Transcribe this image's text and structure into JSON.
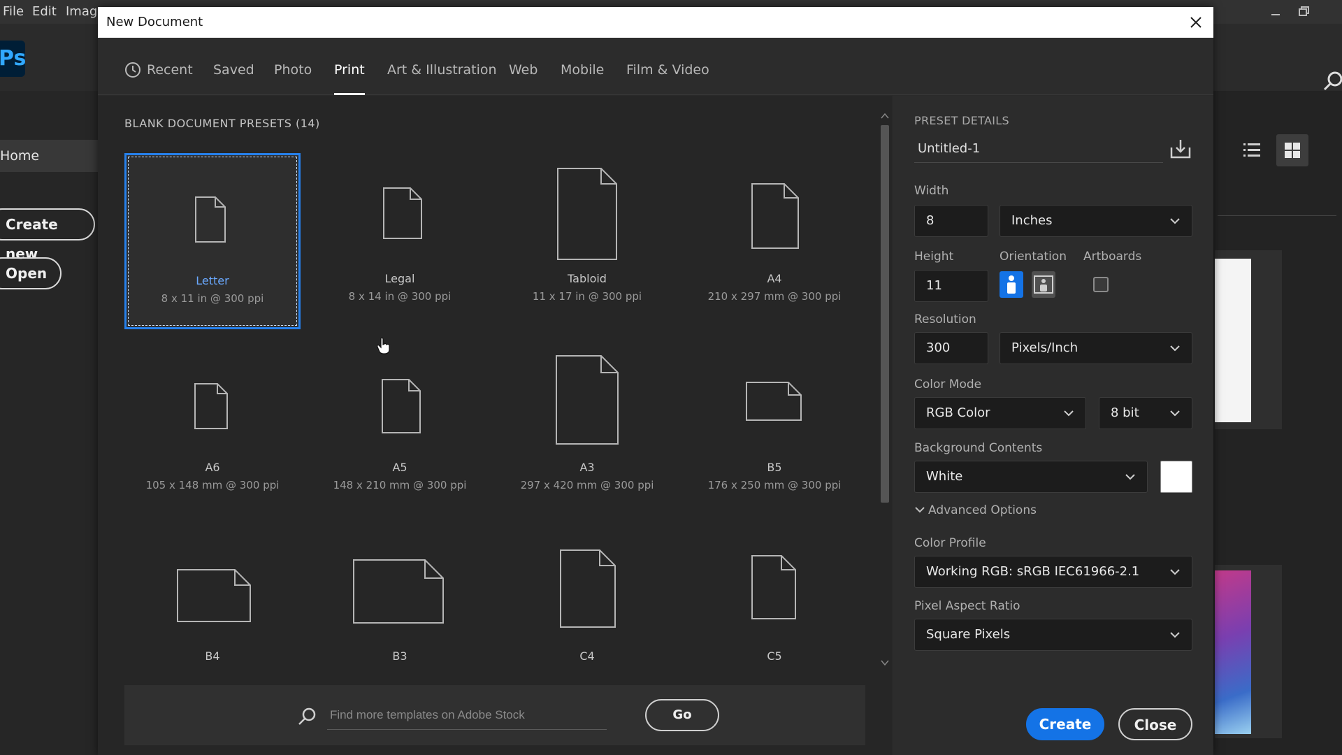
{
  "menubar": {
    "items": [
      "File",
      "Edit",
      "Image"
    ]
  },
  "app": {
    "logo": "Ps",
    "home_label": "Home",
    "create_new_label": "Create new",
    "open_label": "Open"
  },
  "dialog": {
    "title": "New Document",
    "tabs": [
      {
        "label": "Recent",
        "icon": "clock-icon"
      },
      {
        "label": "Saved"
      },
      {
        "label": "Photo"
      },
      {
        "label": "Print",
        "active": true
      },
      {
        "label": "Art & Illustration"
      },
      {
        "label": "Web"
      },
      {
        "label": "Mobile"
      },
      {
        "label": "Film & Video"
      }
    ],
    "presets_heading": "BLANK DOCUMENT PRESETS",
    "presets_count": "(14)",
    "presets": [
      {
        "name": "Letter",
        "size": "8 x 11 in @ 300 ppi",
        "selected": true
      },
      {
        "name": "Legal",
        "size": "8 x 14 in @ 300 ppi"
      },
      {
        "name": "Tabloid",
        "size": "11 x 17 in @ 300 ppi"
      },
      {
        "name": "A4",
        "size": "210 x 297 mm @ 300 ppi"
      },
      {
        "name": "A6",
        "size": "105 x 148 mm @ 300 ppi"
      },
      {
        "name": "A5",
        "size": "148 x 210 mm @ 300 ppi"
      },
      {
        "name": "A3",
        "size": "297 x 420 mm @ 300 ppi"
      },
      {
        "name": "B5",
        "size": "176 x 250 mm @ 300 ppi"
      },
      {
        "name": "B4",
        "size": ""
      },
      {
        "name": "B3",
        "size": ""
      },
      {
        "name": "C4",
        "size": ""
      },
      {
        "name": "C5",
        "size": ""
      }
    ],
    "stock_search": {
      "placeholder": "Find more templates on Adobe Stock",
      "go_label": "Go"
    },
    "details": {
      "heading": "PRESET DETAILS",
      "doc_name": "Untitled-1",
      "width_label": "Width",
      "width_value": "8",
      "width_unit": "Inches",
      "height_label": "Height",
      "height_value": "11",
      "orientation_label": "Orientation",
      "artboards_label": "Artboards",
      "resolution_label": "Resolution",
      "resolution_value": "300",
      "resolution_unit": "Pixels/Inch",
      "color_mode_label": "Color Mode",
      "color_mode_value": "RGB Color",
      "bit_depth_value": "8 bit",
      "bg_contents_label": "Background Contents",
      "bg_contents_value": "White",
      "bg_swatch_color": "#ffffff",
      "advanced_label": "Advanced Options",
      "color_profile_label": "Color Profile",
      "color_profile_value": "Working RGB: sRGB IEC61966-2.1",
      "pixel_aspect_label": "Pixel Aspect Ratio",
      "pixel_aspect_value": "Square Pixels",
      "create_label": "Create",
      "close_label": "Close"
    }
  },
  "colors": {
    "accent": "#1473e6",
    "selection": "#2680eb"
  }
}
